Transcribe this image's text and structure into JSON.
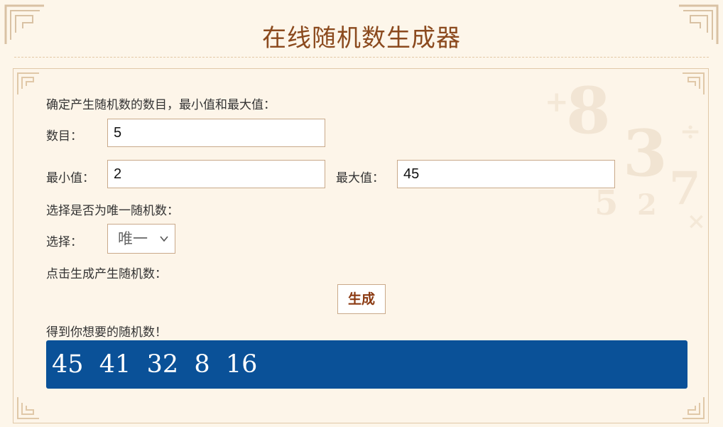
{
  "page": {
    "title": "在线随机数生成器"
  },
  "form": {
    "intro": "确定产生随机数的数目，最小值和最大值：",
    "count_label": "数目：",
    "count_value": "5",
    "min_label": "最小值：",
    "min_value": "2",
    "max_label": "最大值：",
    "max_value": "45",
    "unique_intro": "选择是否为唯一随机数：",
    "choice_label": "选择：",
    "choice_selected": "唯一",
    "generate_intro": "点击生成产生随机数：",
    "generate_button": "生成",
    "result_intro": "得到你想要的随机数！",
    "result_text": "45  41  32  8  16"
  },
  "decor": {
    "background_digits": [
      "8",
      "3",
      "5",
      "2",
      "7",
      "+",
      "-",
      "÷",
      "×"
    ]
  },
  "colors": {
    "title": "#8b4a1e",
    "result_bg": "#0a5198",
    "page_bg": "#fdf6ea",
    "border": "#c9a98a"
  },
  "icons": {
    "corner": "ornamental-corner-icon",
    "select_arrow": "chevron-down-icon"
  }
}
